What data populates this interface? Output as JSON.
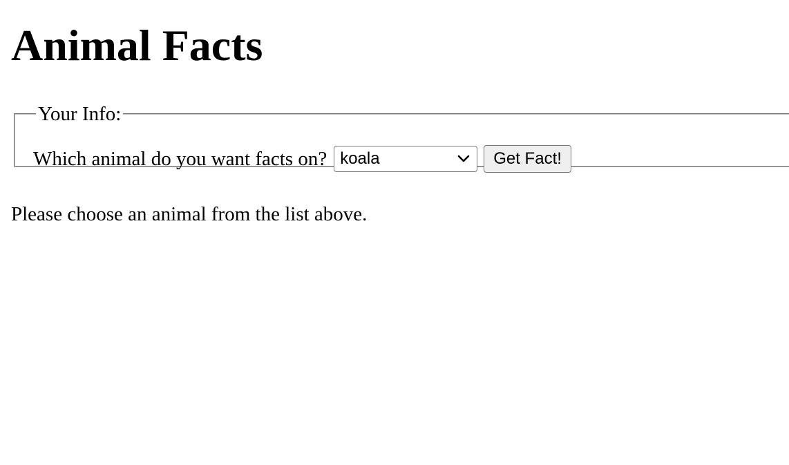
{
  "page": {
    "title": "Animal Facts"
  },
  "form": {
    "legend": "Your Info:",
    "prompt": "Which animal do you want facts on?",
    "select": {
      "selected": "koala"
    },
    "button_label": "Get Fact!"
  },
  "message": "Please choose an animal from the list above.",
  "icons": {
    "select_arrow": "chevron-down-icon"
  }
}
